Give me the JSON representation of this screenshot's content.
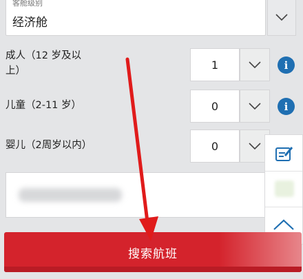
{
  "cabin": {
    "label": "客舱级别",
    "value": "经济舱"
  },
  "passengers": {
    "adult": {
      "label_line1": "成人（12 岁及以",
      "label_line2": "上）",
      "count": "1"
    },
    "child": {
      "label": "儿童（2-11 岁）",
      "count": "0"
    },
    "infant": {
      "label": "婴儿（2周岁以内）",
      "count": "0"
    }
  },
  "info_icon": "i",
  "search_button": {
    "label": "搜索航班"
  },
  "colors": {
    "accent_red": "#d4232c",
    "info_blue": "#1f6fb2",
    "annotation_red": "#e01b1b"
  },
  "icons": [
    "chevron-down-icon",
    "info-icon",
    "edit-icon",
    "chevron-up-icon",
    "arrow-annotation"
  ]
}
